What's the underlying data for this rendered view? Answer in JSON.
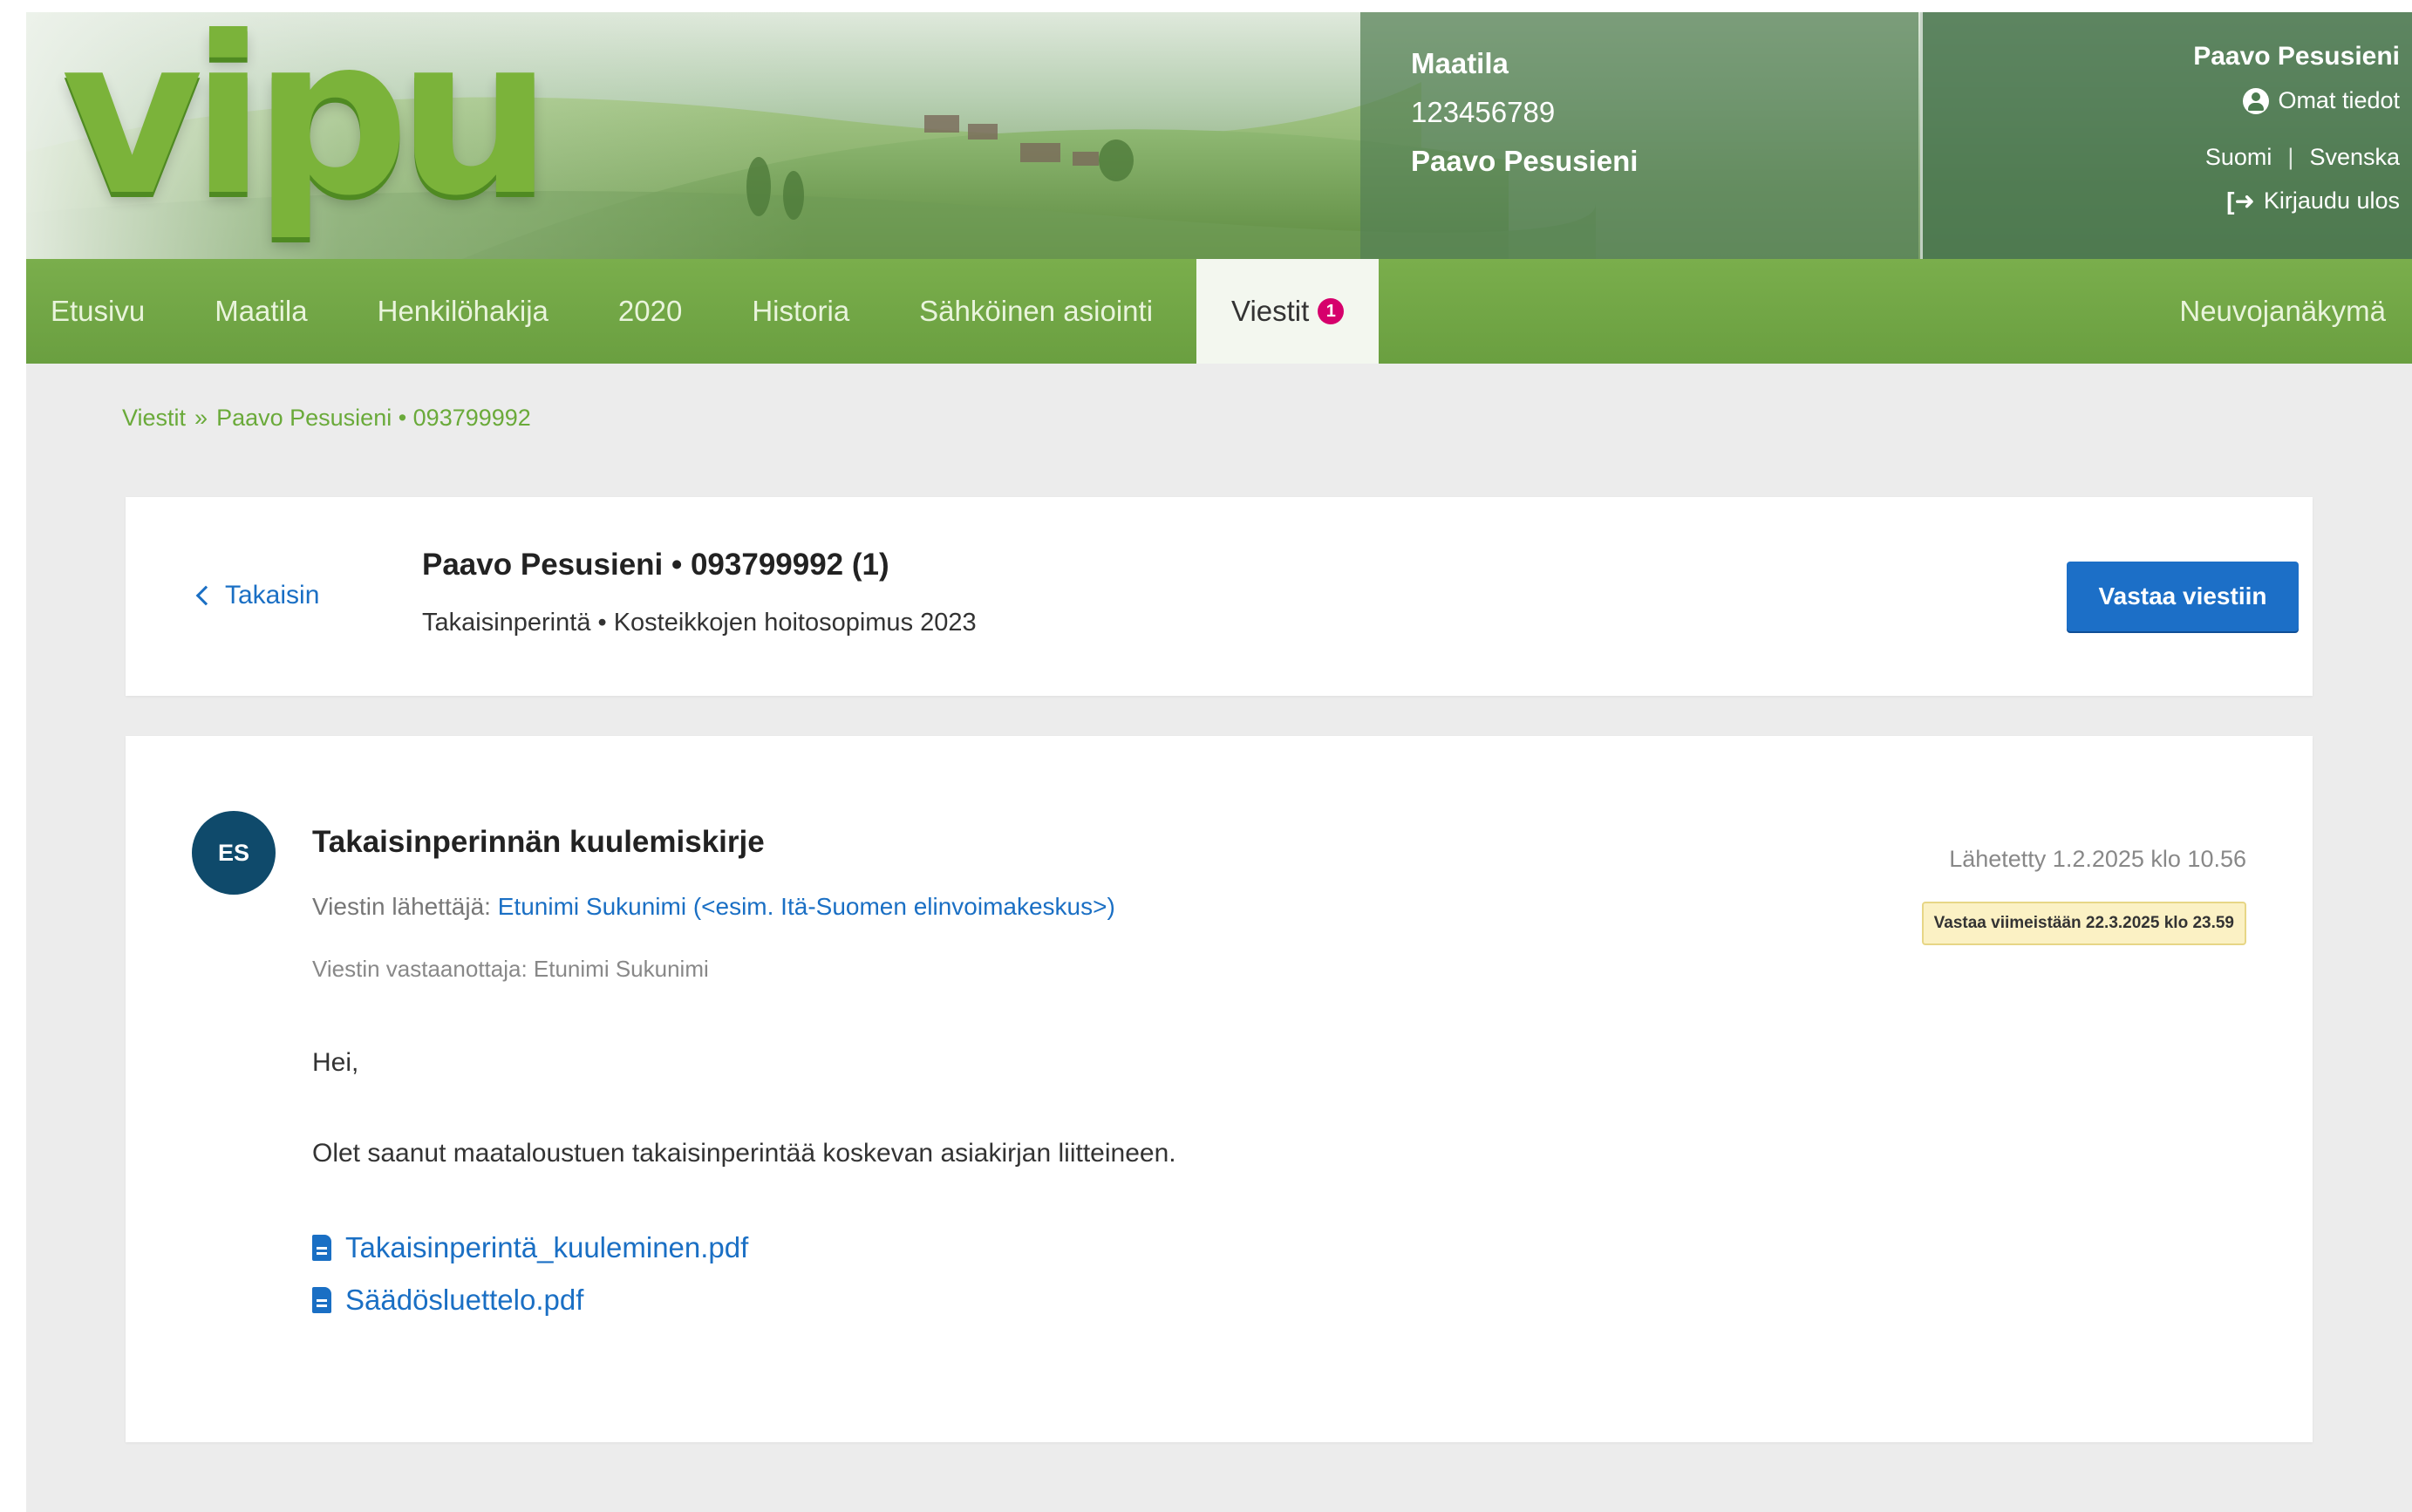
{
  "header": {
    "logo_text": "vipu",
    "farm": {
      "title": "Maatila",
      "id": "123456789",
      "owner": "Paavo Pesusieni"
    },
    "user": {
      "name": "Paavo Pesusieni",
      "own_info": "Omat tiedot",
      "lang_fi": "Suomi",
      "lang_sep": "|",
      "lang_sv": "Svenska",
      "logout": "Kirjaudu ulos"
    }
  },
  "nav": {
    "items": [
      {
        "label": "Etusivu"
      },
      {
        "label": "Maatila"
      },
      {
        "label": "Henkilöhakija"
      },
      {
        "label": "2020"
      },
      {
        "label": "Historia"
      },
      {
        "label": "Sähköinen asiointi"
      }
    ],
    "active": {
      "label": "Viestit",
      "badge": "1"
    },
    "right": {
      "label": "Neuvojanäkymä"
    }
  },
  "breadcrumb": {
    "root": "Viestit",
    "separator": "»",
    "current": "Paavo Pesusieni • 093799992"
  },
  "thread": {
    "back_label": "Takaisin",
    "title": "Paavo Pesusieni • 093799992  (1)",
    "subtitle": "Takaisinperintä • Kosteikkojen hoitosopimus 2023",
    "reply_button": "Vastaa viestiin"
  },
  "message": {
    "avatar_initials": "ES",
    "title": "Takaisinperinnän kuulemiskirje",
    "sender_label": "Viestin lähettäjä:",
    "sender_name": "Etunimi Sukunimi (<esim. Itä-Suomen elinvoimakeskus>)",
    "recipient": "Viestin vastaanottaja: Etunimi Sukunimi",
    "sent": "Lähetetty 1.2.2025 klo 10.56",
    "deadline": "Vastaa viimeistään 22.3.2025 klo 23.59",
    "greeting": "Hei,",
    "body": "Olet saanut maataloustuen takaisinperintää koskevan asiakirjan liitteineen.",
    "attachments": [
      {
        "name": "Takaisinperintä_kuuleminen.pdf",
        "icon": "file-icon"
      },
      {
        "name": "Säädösluettelo.pdf",
        "icon": "file-icon"
      }
    ]
  },
  "colors": {
    "nav_green": "#6a9f40",
    "link_blue": "#1a6fc4",
    "button_blue": "#1c6fc7",
    "badge_magenta": "#d6006c",
    "deadline_bg": "#fbf1c4",
    "avatar_bg": "#0f4a6b"
  }
}
